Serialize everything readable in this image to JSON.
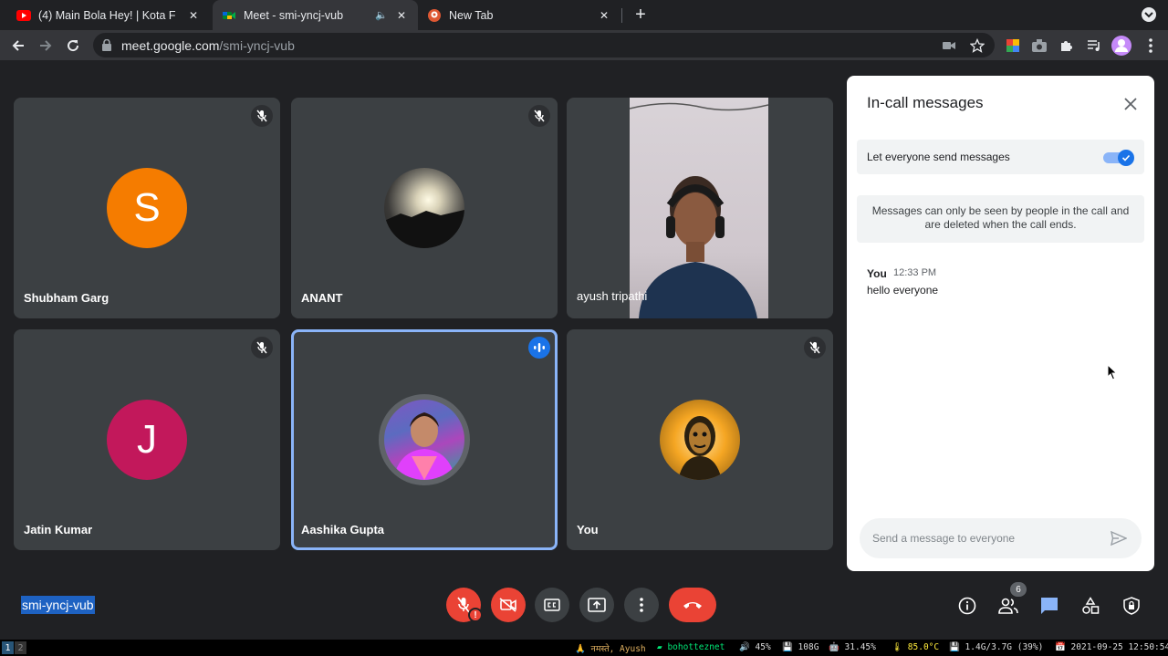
{
  "browser": {
    "tabs": [
      {
        "title": "(4) Main Bola Hey! | Kota F",
        "favicon": "youtube-icon"
      },
      {
        "title": "Meet - smi-yncj-vub",
        "favicon": "meet-icon",
        "active": true
      },
      {
        "title": "New Tab",
        "favicon": "duckduckgo-icon"
      }
    ],
    "url_host": "meet.google.com",
    "url_path": "/smi-yncj-vub"
  },
  "participants": [
    {
      "name": "Shubham Garg",
      "initial": "S",
      "avatar_color": "#f57c00",
      "muted": true
    },
    {
      "name": "ANANT",
      "avatar": "sunset-photo",
      "muted": true
    },
    {
      "name": "ayush tripathi",
      "video": "camera-feed",
      "muted": false
    },
    {
      "name": "Jatin Kumar",
      "initial": "J",
      "avatar_color": "#c2185b",
      "muted": true
    },
    {
      "name": "Aashika Gupta",
      "avatar": "profile-photo",
      "speaking": true
    },
    {
      "name": "You",
      "avatar": "illustration-photo",
      "muted": true
    }
  ],
  "chat": {
    "title": "In-call messages",
    "permission_label": "Let everyone send messages",
    "permission_enabled": true,
    "notice": "Messages can only be seen by people in the call and are deleted when the call ends.",
    "messages": [
      {
        "sender": "You",
        "time": "12:33 PM",
        "text": "hello everyone"
      }
    ],
    "input_placeholder": "Send a message to everyone"
  },
  "controls": {
    "meeting_code": "smi-yncj-vub",
    "mic_alert": "!",
    "people_count": "6"
  },
  "system_bar": {
    "workspaces": [
      "1",
      "2"
    ],
    "greeting": "🙏 नमस्ते, Ayush",
    "wifi": "bohotteznet",
    "volume": "🔊 45%",
    "disk": "💾 108G",
    "cpu": "🤖 31.45%",
    "temp": "🌡 85.0°C",
    "mem": "💾 1.4G/3.7G (39%)",
    "datetime": "📅 2021-09-25 12:50:54"
  },
  "colors": {
    "background": "#202124",
    "tile": "#3c4043",
    "accent_blue": "#1a73e8",
    "danger_red": "#ea4335"
  }
}
